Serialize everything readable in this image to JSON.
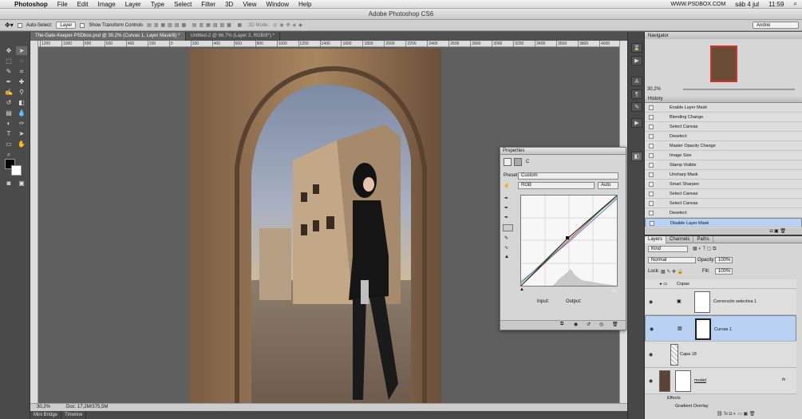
{
  "menubar": {
    "app": "Photoshop",
    "items": [
      "File",
      "Edit",
      "Image",
      "Layer",
      "Type",
      "Select",
      "Filter",
      "3D",
      "View",
      "Window",
      "Help"
    ],
    "site": "WWW.PSDBOX.COM",
    "date": "sáb 4 jul",
    "time": "11:59"
  },
  "window": {
    "title": "Adobe Photoshop CS6"
  },
  "options": {
    "auto_select": "Auto-Select:",
    "auto_select_value": "Layer",
    "show_transform": "Show Transform Controls",
    "mode_3d": "3D Mode:",
    "workspace": "Andrei"
  },
  "doc_tabs": [
    {
      "label": "The-Gate-Keeper-PSDbox.psd @ 30,2% (Curvas 1, Layer Mask/8) *"
    },
    {
      "label": "Untitled-2 @ 66,7% (Layer 2, RGB/8*) *"
    }
  ],
  "ruler": {
    "ticks": [
      "1200",
      "1000",
      "800",
      "600",
      "400",
      "200",
      "0",
      "200",
      "400",
      "600",
      "800",
      "1000",
      "1200",
      "1400",
      "1600",
      "1800",
      "2000",
      "2200",
      "2400",
      "2600",
      "2800",
      "3000",
      "3200",
      "3400",
      "3600",
      "3800",
      "4000"
    ]
  },
  "status": {
    "zoom": "30,2%",
    "doc": "Doc: 17,2M/375,5M"
  },
  "bottom_tabs": [
    "Mini Bridge",
    "Timeline"
  ],
  "properties": {
    "title": "Properties",
    "label_c": "C",
    "preset_label": "Preset:",
    "preset_value": "Custom",
    "channel_value": "RGB",
    "auto_label": "Auto",
    "input_label": "Input:",
    "output_label": "Output:"
  },
  "navigator": {
    "title": "Navigator",
    "zoom": "30,2%"
  },
  "history": {
    "title": "History",
    "items": [
      "Enable Layer Mask",
      "Blending Change",
      "Select Canvas",
      "Deselect",
      "Master Opacity Change",
      "Image Size",
      "Stamp Visible",
      "Unsharp Mask",
      "Smart Sharpen",
      "Select Canvas",
      "Select Canvas",
      "Deselect",
      "Disable Layer Mask"
    ]
  },
  "layers": {
    "tabs": [
      "Layers",
      "Channels",
      "Paths"
    ],
    "kind": "Kind",
    "blend": "Normal",
    "opacity_label": "Opacity:",
    "opacity": "100%",
    "lock_label": "Lock:",
    "fill_label": "Fill:",
    "fill": "100%",
    "rows": [
      "Copas",
      "Corrección selectiva 1",
      "Curvas 1",
      "Capa 18",
      "model"
    ],
    "effects": "Effects",
    "gradient_overlay": "Gradient Overlay",
    "fx": "fx"
  },
  "colors": {
    "accent": "#b9d1f2",
    "panel": "#d6d6d6"
  }
}
